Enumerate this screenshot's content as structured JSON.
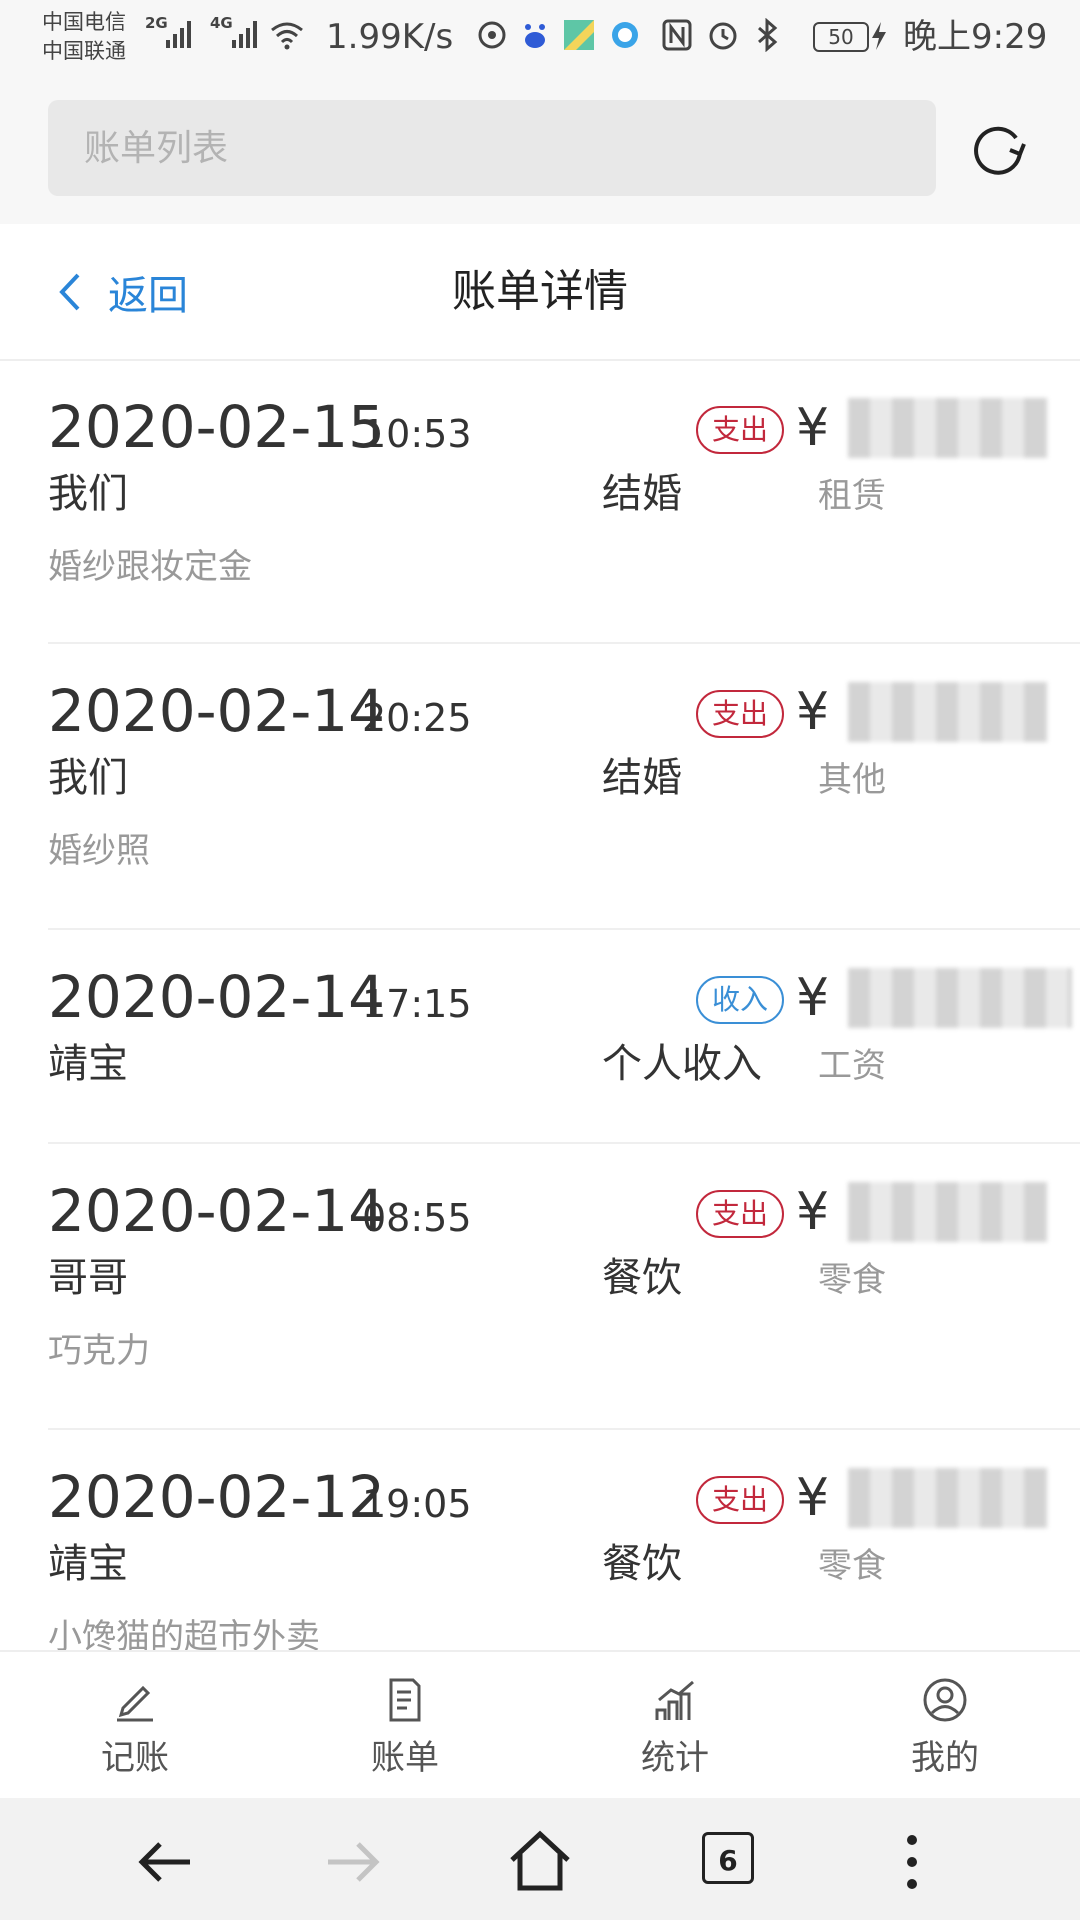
{
  "status_bar": {
    "carrier_1": "中国电信",
    "carrier_2": "中国联通",
    "net_2g": "2G",
    "net_4g": "4G",
    "speed": "1.99K/s",
    "battery": "50",
    "time": "晚上9:29"
  },
  "browser": {
    "address_placeholder": "账单列表"
  },
  "header": {
    "back_label": "返回",
    "title": "账单详情"
  },
  "bills": [
    {
      "date": "2020-02-15",
      "time": "10:53",
      "type": "支出",
      "currency": "¥",
      "member": "我们",
      "category": "结婚",
      "subcategory": "租赁",
      "note": "婚纱跟妆定金"
    },
    {
      "date": "2020-02-14",
      "time": "20:25",
      "type": "支出",
      "currency": "¥",
      "member": "我们",
      "category": "结婚",
      "subcategory": "其他",
      "note": "婚纱照"
    },
    {
      "date": "2020-02-14",
      "time": "17:15",
      "type": "收入",
      "currency": "¥",
      "member": "靖宝",
      "category": "个人收入",
      "subcategory": "工资",
      "note": ""
    },
    {
      "date": "2020-02-14",
      "time": "08:55",
      "type": "支出",
      "currency": "¥",
      "member": "哥哥",
      "category": "餐饮",
      "subcategory": "零食",
      "note": "巧克力"
    },
    {
      "date": "2020-02-12",
      "time": "19:05",
      "type": "支出",
      "currency": "¥",
      "member": "靖宝",
      "category": "餐饮",
      "subcategory": "零食",
      "note": "小馋猫的超市外卖"
    }
  ],
  "tabbar": {
    "items": [
      {
        "label": "记账",
        "icon": "pencil-icon"
      },
      {
        "label": "账单",
        "icon": "bill-icon"
      },
      {
        "label": "统计",
        "icon": "chart-icon"
      },
      {
        "label": "我的",
        "icon": "profile-icon"
      }
    ]
  },
  "browser_nav": {
    "tab_count": "6"
  },
  "colors": {
    "accent": "#2a85d8",
    "expense": "#c2283c",
    "income": "#3a8fd6"
  }
}
